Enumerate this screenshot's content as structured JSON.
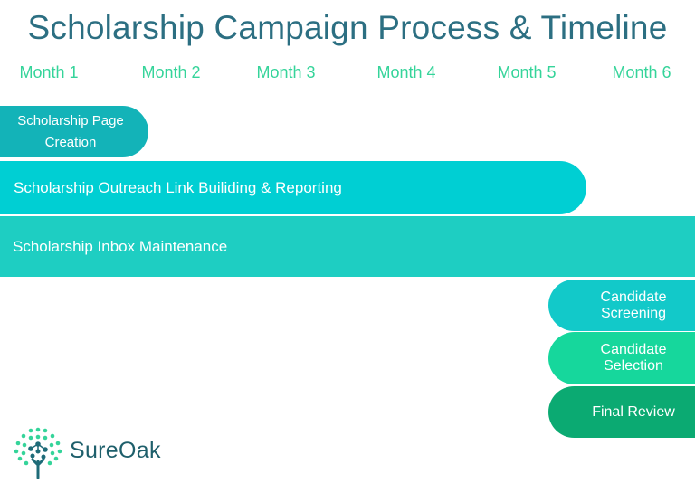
{
  "title": "Scholarship Campaign Process & Timeline",
  "months": [
    "Month 1",
    "Month 2",
    "Month 3",
    "Month 4",
    "Month 5",
    "Month 6"
  ],
  "tasks": {
    "page_creation_line1": "Scholarship Page",
    "page_creation_line2": "Creation",
    "outreach": "Scholarship Outreach Link Builiding & Reporting",
    "inbox": "Scholarship Inbox Maintenance",
    "screening_line1": "Candidate",
    "screening_line2": "Screening",
    "selection_line1": "Candidate",
    "selection_line2": "Selection",
    "final_review": "Final Review"
  },
  "brand": {
    "name": "SureOak",
    "logo_icon": "tree-icon"
  },
  "colors": {
    "title": "#2c6f82",
    "months": "#35d49a",
    "page_creation": "#13b3b8",
    "outreach": "#00cfd3",
    "inbox": "#1ecec2",
    "screening": "#12c9c9",
    "selection": "#16d79c",
    "final_review": "#0baa72"
  }
}
